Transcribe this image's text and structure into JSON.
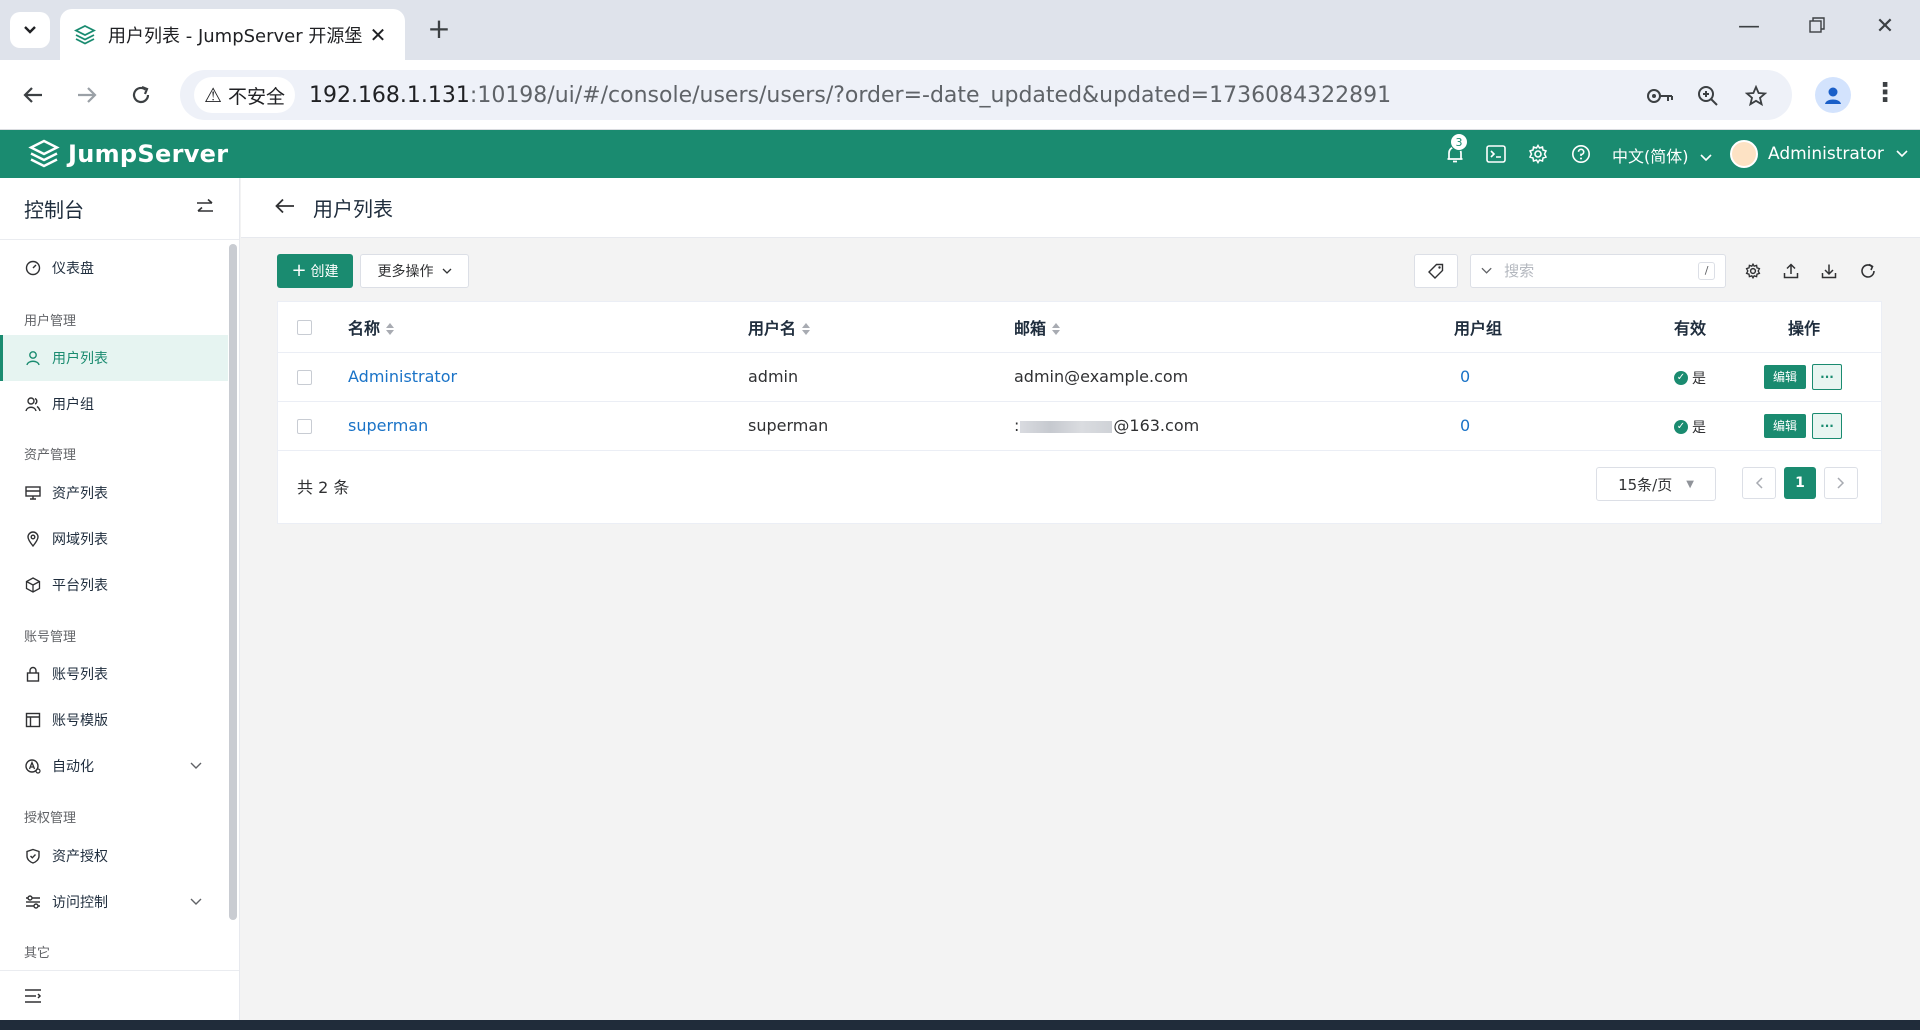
{
  "browser": {
    "tab_title": "用户列表 - JumpServer 开源堡",
    "insecure_label": "不安全",
    "url_host": "192.168.1.131",
    "url_rest": ":10198/ui/#/console/users/users/?order=-date_updated&updated=1736084322891"
  },
  "header": {
    "logo_text": "JumpServer",
    "notification_count": "3",
    "language": "中文(简体)",
    "user_name": "Administrator",
    "brand_color": "#1a8b70"
  },
  "sidebar": {
    "title": "控制台",
    "dashboard": "仪表盘",
    "sections": {
      "user_mgmt": "用户管理",
      "asset_mgmt": "资产管理",
      "account_mgmt": "账号管理",
      "perm_mgmt": "授权管理",
      "other": "其它"
    },
    "items": {
      "user_list": "用户列表",
      "user_group": "用户组",
      "asset_list": "资产列表",
      "zone_list": "网域列表",
      "platform_list": "平台列表",
      "account_list": "账号列表",
      "account_template": "账号模版",
      "automation": "自动化",
      "asset_perm": "资产授权",
      "access_control": "访问控制"
    }
  },
  "page": {
    "title": "用户列表",
    "create_label": "创建",
    "more_actions_label": "更多操作",
    "search_placeholder": "搜索",
    "search_shortcut": "/"
  },
  "table": {
    "headers": {
      "name": "名称",
      "username": "用户名",
      "email": "邮箱",
      "groups": "用户组",
      "valid": "有效",
      "actions": "操作"
    },
    "rows": [
      {
        "name": "Administrator",
        "username": "admin",
        "email": "admin@example.com",
        "groups": "0",
        "valid": "是",
        "edit": "编辑"
      },
      {
        "name": "superman",
        "username": "superman",
        "email_prefix": ":",
        "email_suffix": "@163.com",
        "groups": "0",
        "valid": "是",
        "edit": "编辑"
      }
    ],
    "total": "共 2 条",
    "page_size": "15条/页",
    "current_page": "1"
  }
}
